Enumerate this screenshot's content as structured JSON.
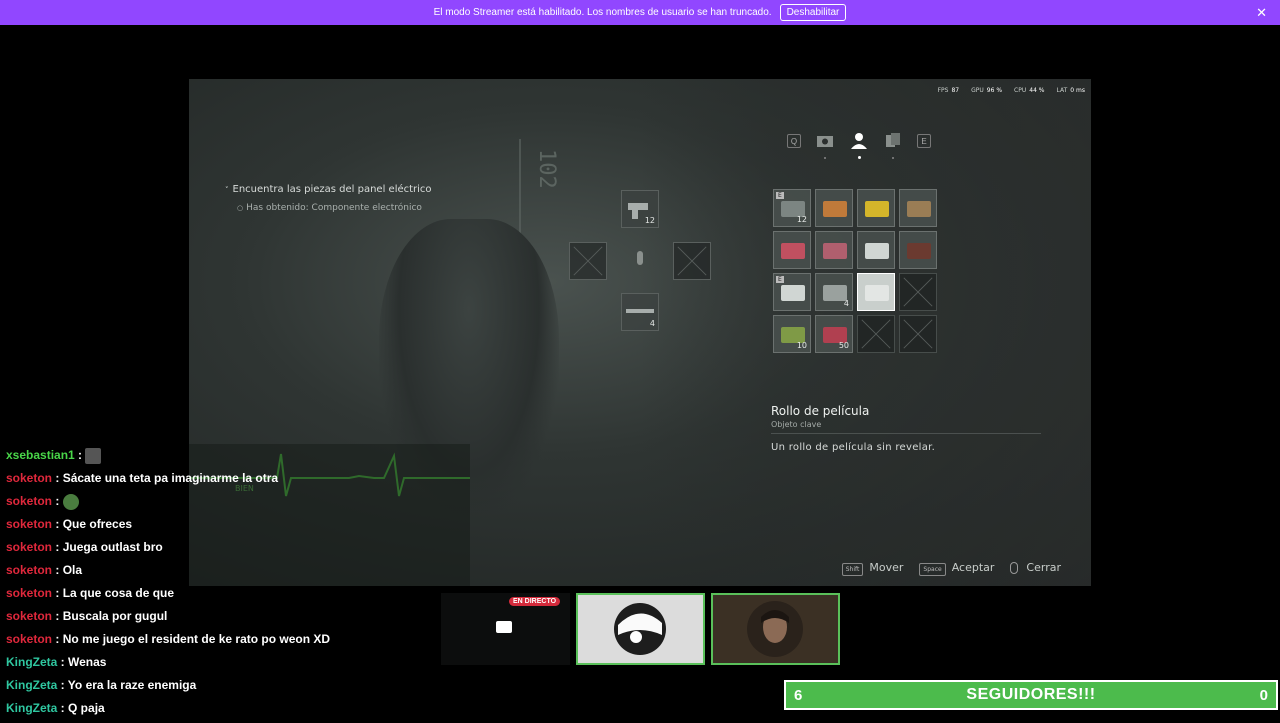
{
  "banner": {
    "text": "El modo Streamer está habilitado. Los nombres de usuario se han truncado.",
    "button_label": "Deshabilitar",
    "close_glyph": "✕",
    "bg_color": "#9147ff"
  },
  "game": {
    "door_number": "102",
    "perf": {
      "fps_label": "FPS",
      "fps_value": "87",
      "gpu_label": "GPU",
      "gpu_value": "96 %",
      "cpu_label": "CPU",
      "cpu_value": "44 %",
      "lat_label": "LAT",
      "lat_value": "0 ms"
    },
    "objective": {
      "title": "Encuentra las piezas del panel eléctrico",
      "sub": "Has obtenido: Componente electrónico"
    },
    "tabs": {
      "left_key": "Q",
      "right_key": "E",
      "icons": [
        "map-icon",
        "camera-icon",
        "character-icon",
        "files-icon"
      ]
    },
    "equip": {
      "top_count": "12",
      "bottom_count": "4"
    },
    "inventory": [
      {
        "icon": "pistol-icon",
        "count": "12",
        "badge": "E",
        "color": "#7c8582"
      },
      {
        "icon": "ammo-box-icon",
        "count": "",
        "badge": "",
        "color": "#c07a3a"
      },
      {
        "icon": "gold-bar-icon",
        "count": "",
        "badge": "",
        "color": "#d4b52a"
      },
      {
        "icon": "map-item-icon",
        "count": "",
        "badge": "",
        "color": "#9a7d55"
      },
      {
        "icon": "crank-icon",
        "count": "",
        "badge": "",
        "color": "#c05060"
      },
      {
        "icon": "rod-icon",
        "count": "",
        "badge": "",
        "color": "#b05f6e"
      },
      {
        "icon": "knife-icon",
        "count": "",
        "badge": "",
        "color": "#d0d6d3"
      },
      {
        "icon": "book-icon",
        "count": "",
        "badge": "",
        "color": "#6b3a30"
      },
      {
        "icon": "knife-icon",
        "count": "",
        "badge": "E",
        "color": "#d0d6d3"
      },
      {
        "icon": "gun-parts-icon",
        "count": "4",
        "badge": "",
        "color": "#9aa19e"
      },
      {
        "icon": "film-roll-icon",
        "count": "",
        "badge": "",
        "color": "#e3e6e4",
        "selected": true
      },
      {
        "icon": "empty-slot-icon",
        "count": "",
        "badge": "",
        "color": "",
        "empty": true
      },
      {
        "icon": "herb-icon",
        "count": "10",
        "badge": "",
        "color": "#7f9a46"
      },
      {
        "icon": "shells-icon",
        "count": "50",
        "badge": "",
        "color": "#b04050"
      },
      {
        "icon": "empty-slot-icon",
        "count": "",
        "badge": "",
        "color": "",
        "empty": true
      },
      {
        "icon": "empty-slot-icon",
        "count": "",
        "badge": "",
        "color": "",
        "empty": true
      }
    ],
    "item": {
      "name": "Rollo de película",
      "type": "Objeto clave",
      "description": "Un rollo de película sin revelar."
    },
    "controls": {
      "move_key": "Shift",
      "move_label": "Mover",
      "accept_key": "Space",
      "accept_label": "Aceptar",
      "close_label": "Cerrar"
    },
    "health_label": "BIEN"
  },
  "chat": [
    {
      "user": "xsebastian1",
      "color": "#49d649",
      "text": ""
    },
    {
      "user": "soketon",
      "color": "#e0283c",
      "text": "Sácate una teta pa imaginarme la otra"
    },
    {
      "user": "soketon",
      "color": "#e0283c",
      "text": ""
    },
    {
      "user": "soketon",
      "color": "#e0283c",
      "text": "Que ofreces"
    },
    {
      "user": "soketon",
      "color": "#e0283c",
      "text": "Juega outlast bro"
    },
    {
      "user": "soketon",
      "color": "#e0283c",
      "text": "Ola"
    },
    {
      "user": "soketon",
      "color": "#e0283c",
      "text": "La que cosa de que"
    },
    {
      "user": "soketon",
      "color": "#e0283c",
      "text": "Buscala por gugul"
    },
    {
      "user": "soketon",
      "color": "#e0283c",
      "text": "No me juego el resident de ke rato po weon XD"
    },
    {
      "user": "KingZeta",
      "color": "#2fc7a0",
      "text": "Wenas"
    },
    {
      "user": "KingZeta",
      "color": "#2fc7a0",
      "text": "Yo era la raze enemiga"
    },
    {
      "user": "KingZeta",
      "color": "#2fc7a0",
      "text": "Q paja"
    }
  ],
  "cams": {
    "live_badge": "EN DIRECTO"
  },
  "followers": {
    "current": "6",
    "label": "SEGUIDORES!!!",
    "goal": "0",
    "color": "#4cbb4c"
  }
}
